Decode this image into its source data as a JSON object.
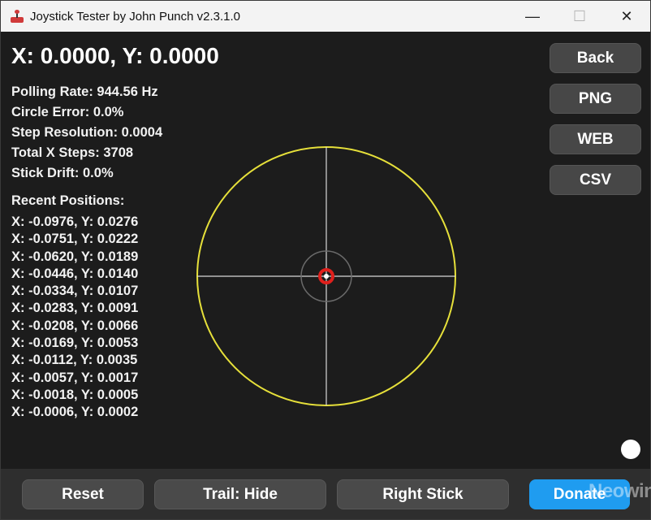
{
  "window": {
    "title": "Joystick Tester by John Punch v2.3.1.0",
    "controls": {
      "minimize": "—",
      "maximize": "☐",
      "close": "✕"
    }
  },
  "readout": {
    "coords": "X: 0.0000, Y: 0.0000"
  },
  "stats": {
    "polling_rate": "Polling Rate: 944.56 Hz",
    "circle_error": "Circle Error: 0.0%",
    "step_resolution": "Step Resolution: 0.0004",
    "total_x_steps": "Total X Steps: 3708",
    "stick_drift": "Stick Drift: 0.0%"
  },
  "recent": {
    "title": "Recent Positions:",
    "positions": [
      "X: -0.0976, Y: 0.0276",
      "X: -0.0751, Y: 0.0222",
      "X: -0.0620, Y: 0.0189",
      "X: -0.0446, Y: 0.0140",
      "X: -0.0334, Y: 0.0107",
      "X: -0.0283, Y: 0.0091",
      "X: -0.0208, Y: 0.0066",
      "X: -0.0169, Y: 0.0053",
      "X: -0.0112, Y: 0.0035",
      "X: -0.0057, Y: 0.0017",
      "X: -0.0018, Y: 0.0005",
      "X: -0.0006, Y: 0.0002"
    ]
  },
  "sidebar": {
    "back": "Back",
    "png": "PNG",
    "web": "WEB",
    "csv": "CSV"
  },
  "footer": {
    "reset": "Reset",
    "trail": "Trail: Hide",
    "right_stick": "Right Stick",
    "donate": "Donate",
    "watermark": "Neowin"
  },
  "visual": {
    "stick_position": {
      "x": 0.0,
      "y": 0.0
    },
    "colors": {
      "outer_circle": "#e6e03a",
      "crosshair": "#d8d8d8",
      "deadzone_circle": "#6a6a6a",
      "marker": "#e0201c",
      "donate": "#1f9cf0"
    }
  }
}
